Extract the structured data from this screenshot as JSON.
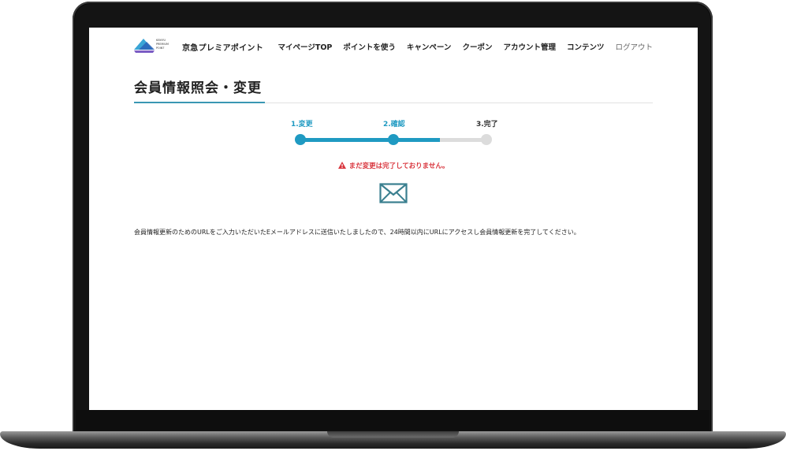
{
  "header": {
    "logo_text": "KEIKYU PREMIUM POINT",
    "brand": "京急プレミアポイント",
    "nav": [
      {
        "label": "マイページTOP"
      },
      {
        "label": "ポイントを使う"
      },
      {
        "label": "キャンペーン"
      },
      {
        "label": "クーポン"
      },
      {
        "label": "アカウント管理"
      },
      {
        "label": "コンテンツ"
      },
      {
        "label": "ログアウト"
      }
    ]
  },
  "page": {
    "title": "会員情報照会・変更"
  },
  "stepper": {
    "steps": [
      {
        "label": "1.変更",
        "state": "active"
      },
      {
        "label": "2.確認",
        "state": "active"
      },
      {
        "label": "3.完了",
        "state": "inactive"
      }
    ],
    "progress": 0.75
  },
  "notice": {
    "warning": "まだ変更は完了しておりません。",
    "icon": "mail-icon",
    "message": "会員情報更新のためのURLをご入力いただいたEメールアドレスに送信いたしましたので、24時間以内にURLにアクセスし会員情報更新を完了してください。"
  },
  "colors": {
    "accent": "#1f9ac2",
    "warning": "#d9363e",
    "inactive": "#dcdcdc"
  }
}
